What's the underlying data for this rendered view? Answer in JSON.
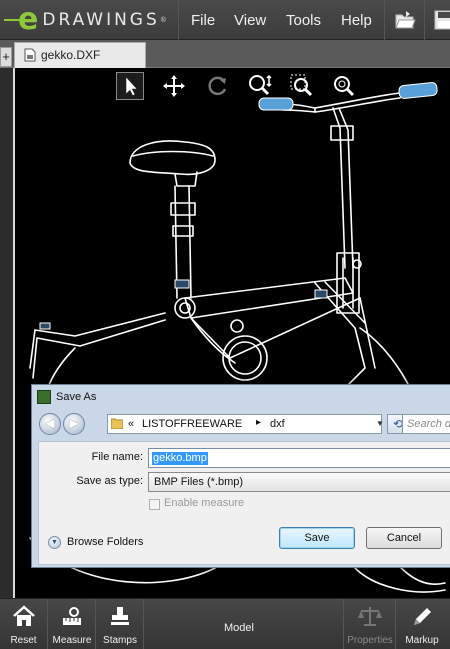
{
  "app": {
    "logo_text": "DRAWINGS",
    "logo_mark": "e",
    "logo_reg": "®"
  },
  "menu": {
    "items": [
      "File",
      "View",
      "Tools",
      "Help"
    ],
    "open_icon": "open-folder-icon",
    "save_icon": "save-icon"
  },
  "tabs": {
    "add_label": "+",
    "active_tab": "gekko.DXF"
  },
  "view_tools": [
    "select-arrow-icon",
    "pan-icon",
    "rotate-icon",
    "zoom-fit-icon",
    "zoom-area-icon",
    "zoom-icon"
  ],
  "dialog": {
    "title": "Save As",
    "nav": {
      "back": "◀",
      "forward": "▶",
      "path_prefix": "«",
      "path": [
        "LISTOFFREEWARE",
        "dxf"
      ],
      "path_arrow": "▸",
      "search_placeholder": "Search dxf"
    },
    "file_name_label": "File name:",
    "file_name_value": "gekko.bmp",
    "save_type_label": "Save as type:",
    "save_type_value": "BMP Files (*.bmp)",
    "enable_measure_label": "Enable measure",
    "enable_measure_checked": false,
    "browse_folders_label": "Browse Folders",
    "save_button": "Save",
    "cancel_button": "Cancel"
  },
  "toolbar": {
    "reset": "Reset",
    "measure": "Measure",
    "stamps": "Stamps",
    "model": "Model",
    "properties": "Properties",
    "markup": "Markup"
  },
  "colors": {
    "accent_green": "#8fc93a",
    "drawing_line": "#ffffff",
    "grip_blue": "#5aa0d8"
  }
}
